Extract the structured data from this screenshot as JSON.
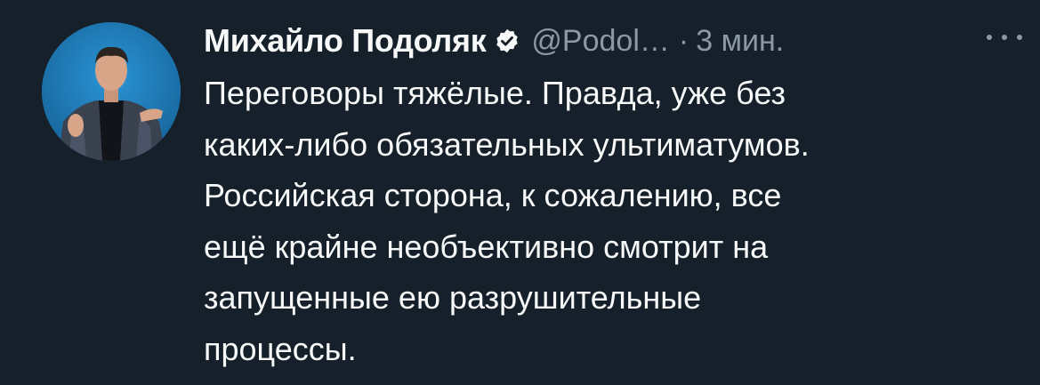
{
  "tweet": {
    "author_name": "Михайло Подоляк",
    "verified_icon": "verified-badge-icon",
    "handle": "@Podol…",
    "separator": "·",
    "time": "3 мин.",
    "more_icon": "more-options-icon",
    "text_lines": [
      "Переговоры тяжёлые. Правда, уже без",
      "каких-либо обязательных ультиматумов.",
      "Российская сторона, к сожалению, все",
      "ещё крайне необъективно смотрит на",
      "запущенные ею разрушительные",
      "процессы."
    ]
  },
  "colors": {
    "background": "#15202b",
    "text": "#f7f9f9",
    "secondary": "#8b98a5",
    "avatar_bg": "#1f7fbf"
  }
}
